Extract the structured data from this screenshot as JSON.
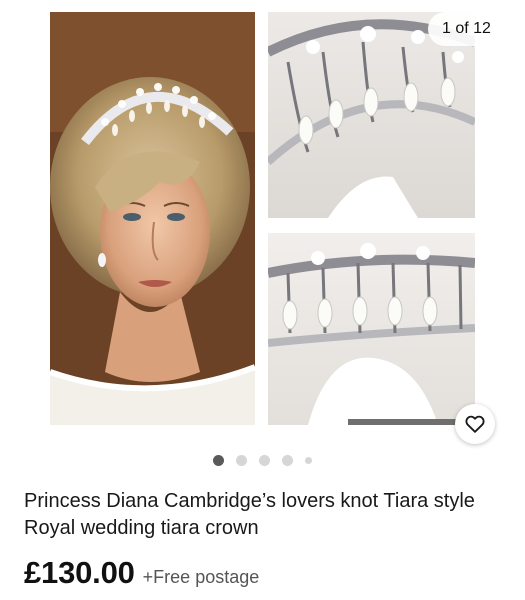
{
  "gallery": {
    "counter": "1 of 12",
    "dots": {
      "count": 5,
      "active_index": 0
    }
  },
  "listing": {
    "title": "Princess Diana Cambridge’s lovers knot Tiara style Royal wedding tiara crown",
    "price": "£130.00",
    "shipping": "+Free postage"
  },
  "icons": {
    "watch": "heart-icon"
  }
}
